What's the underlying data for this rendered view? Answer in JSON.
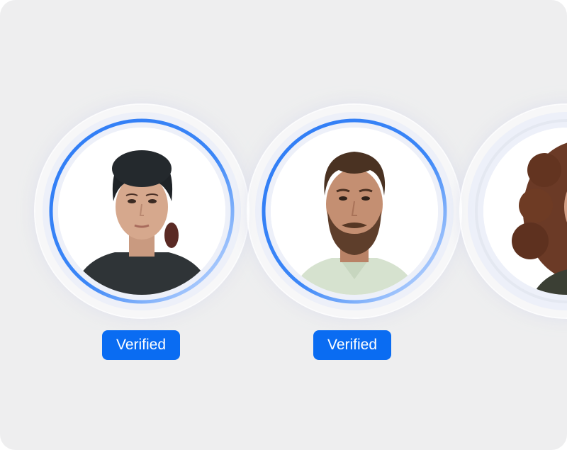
{
  "profiles": [
    {
      "person": "woman-with-headwrap",
      "status_badge": "Verified",
      "verification_ring": "active"
    },
    {
      "person": "bearded-man",
      "status_badge": "Verified",
      "verification_ring": "active"
    },
    {
      "person": "woman-with-curly-hair",
      "status_badge": "",
      "verification_ring": "inactive"
    }
  ],
  "colors": {
    "background": "#eeeeef",
    "accent": "#0a6cf2",
    "ring_light": "#c9dcff",
    "badge_text": "#ffffff"
  },
  "icons": {
    "ring": "verification-progress-ring"
  }
}
